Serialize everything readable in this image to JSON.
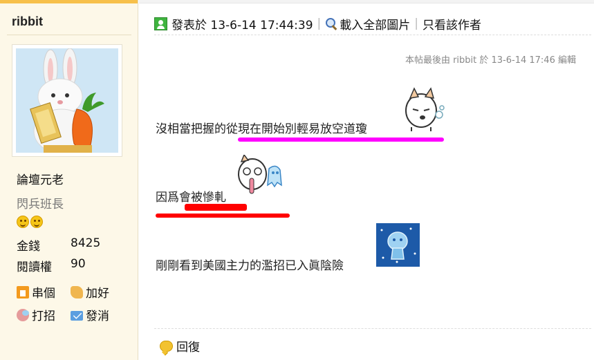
{
  "user": {
    "name": "ribbit",
    "rank": "論壇元老",
    "title": "閃兵班長",
    "stats": [
      {
        "label": "金錢",
        "value": "8425"
      },
      {
        "label": "閱讀權",
        "value": "90"
      }
    ],
    "actions": [
      {
        "label": "串個",
        "icon": "home-icon"
      },
      {
        "label": "加好",
        "icon": "handshake-icon"
      },
      {
        "label": "打招",
        "icon": "chat-icon"
      },
      {
        "label": "發消",
        "icon": "mail-icon"
      }
    ]
  },
  "post": {
    "posted_label": "發表於 13-6-14 17:44:39",
    "view_all_images": "載入全部圖片",
    "only_author": "只看該作者",
    "edit_note": "本帖最後由 ribbit 於 13-6-14 17:46 編輯",
    "lines": [
      "沒相當把握的從現在開始別輕易放空道瓊",
      "因爲會被慘軋",
      "剛剛看到美國主力的濫招已入眞陰險"
    ],
    "reply_label": "回復"
  },
  "colors": {
    "sidebar_bg": "#fdf8e8",
    "accent_orange": "#f7c04a",
    "underline_magenta": "#ff00ff",
    "underline_red": "#ff0000"
  }
}
